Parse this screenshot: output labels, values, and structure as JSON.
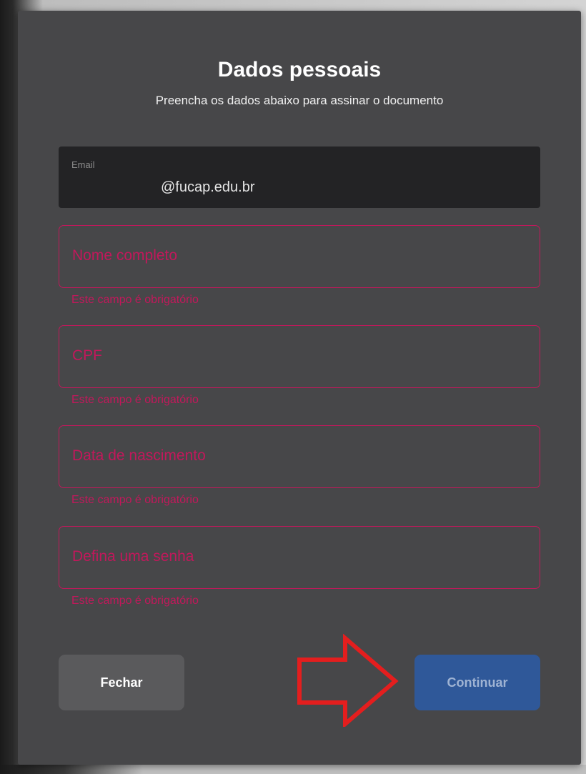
{
  "dialog": {
    "title": "Dados pessoais",
    "subtitle": "Preencha os dados abaixo para assinar o documento"
  },
  "email": {
    "label": "Email",
    "value": "@fucap.edu.br"
  },
  "fields": [
    {
      "placeholder": "Nome completo",
      "error": "Este campo é obrigatório"
    },
    {
      "placeholder": "CPF",
      "error": "Este campo é obrigatório"
    },
    {
      "placeholder": "Data de nascimento",
      "error": "Este campo é obrigatório"
    },
    {
      "placeholder": "Defina uma senha",
      "error": "Este campo é obrigatório"
    }
  ],
  "buttons": {
    "close_label": "Fechar",
    "continue_label": "Continuar"
  },
  "colors": {
    "modal_bg": "#474749",
    "error": "#c2185b",
    "primary": "#2f5899",
    "annotation_arrow": "#e41e1e"
  }
}
